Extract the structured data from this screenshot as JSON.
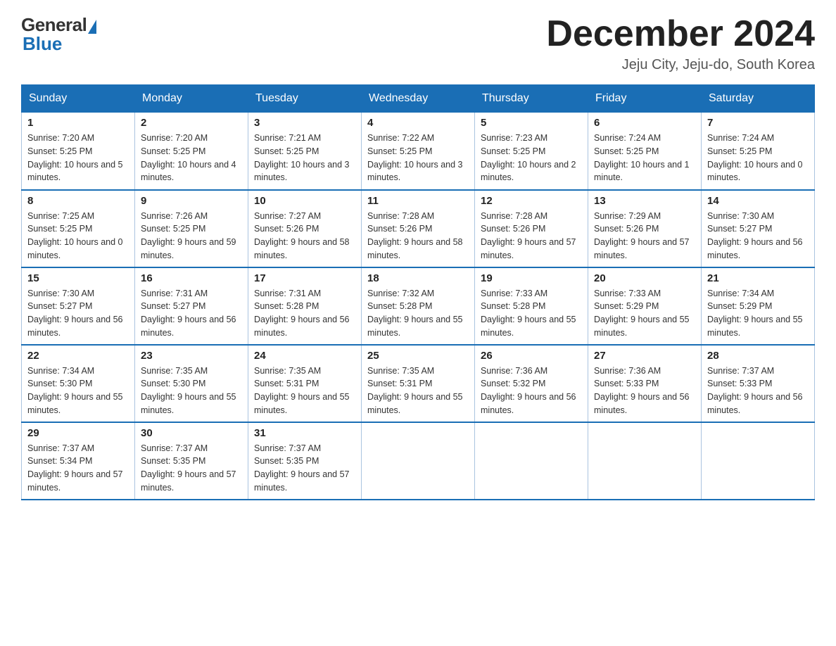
{
  "header": {
    "logo_general": "General",
    "logo_blue": "Blue",
    "month_title": "December 2024",
    "subtitle": "Jeju City, Jeju-do, South Korea"
  },
  "days_of_week": [
    "Sunday",
    "Monday",
    "Tuesday",
    "Wednesday",
    "Thursday",
    "Friday",
    "Saturday"
  ],
  "weeks": [
    [
      {
        "day": "1",
        "sunrise": "7:20 AM",
        "sunset": "5:25 PM",
        "daylight": "10 hours and 5 minutes."
      },
      {
        "day": "2",
        "sunrise": "7:20 AM",
        "sunset": "5:25 PM",
        "daylight": "10 hours and 4 minutes."
      },
      {
        "day": "3",
        "sunrise": "7:21 AM",
        "sunset": "5:25 PM",
        "daylight": "10 hours and 3 minutes."
      },
      {
        "day": "4",
        "sunrise": "7:22 AM",
        "sunset": "5:25 PM",
        "daylight": "10 hours and 3 minutes."
      },
      {
        "day": "5",
        "sunrise": "7:23 AM",
        "sunset": "5:25 PM",
        "daylight": "10 hours and 2 minutes."
      },
      {
        "day": "6",
        "sunrise": "7:24 AM",
        "sunset": "5:25 PM",
        "daylight": "10 hours and 1 minute."
      },
      {
        "day": "7",
        "sunrise": "7:24 AM",
        "sunset": "5:25 PM",
        "daylight": "10 hours and 0 minutes."
      }
    ],
    [
      {
        "day": "8",
        "sunrise": "7:25 AM",
        "sunset": "5:25 PM",
        "daylight": "10 hours and 0 minutes."
      },
      {
        "day": "9",
        "sunrise": "7:26 AM",
        "sunset": "5:25 PM",
        "daylight": "9 hours and 59 minutes."
      },
      {
        "day": "10",
        "sunrise": "7:27 AM",
        "sunset": "5:26 PM",
        "daylight": "9 hours and 58 minutes."
      },
      {
        "day": "11",
        "sunrise": "7:28 AM",
        "sunset": "5:26 PM",
        "daylight": "9 hours and 58 minutes."
      },
      {
        "day": "12",
        "sunrise": "7:28 AM",
        "sunset": "5:26 PM",
        "daylight": "9 hours and 57 minutes."
      },
      {
        "day": "13",
        "sunrise": "7:29 AM",
        "sunset": "5:26 PM",
        "daylight": "9 hours and 57 minutes."
      },
      {
        "day": "14",
        "sunrise": "7:30 AM",
        "sunset": "5:27 PM",
        "daylight": "9 hours and 56 minutes."
      }
    ],
    [
      {
        "day": "15",
        "sunrise": "7:30 AM",
        "sunset": "5:27 PM",
        "daylight": "9 hours and 56 minutes."
      },
      {
        "day": "16",
        "sunrise": "7:31 AM",
        "sunset": "5:27 PM",
        "daylight": "9 hours and 56 minutes."
      },
      {
        "day": "17",
        "sunrise": "7:31 AM",
        "sunset": "5:28 PM",
        "daylight": "9 hours and 56 minutes."
      },
      {
        "day": "18",
        "sunrise": "7:32 AM",
        "sunset": "5:28 PM",
        "daylight": "9 hours and 55 minutes."
      },
      {
        "day": "19",
        "sunrise": "7:33 AM",
        "sunset": "5:28 PM",
        "daylight": "9 hours and 55 minutes."
      },
      {
        "day": "20",
        "sunrise": "7:33 AM",
        "sunset": "5:29 PM",
        "daylight": "9 hours and 55 minutes."
      },
      {
        "day": "21",
        "sunrise": "7:34 AM",
        "sunset": "5:29 PM",
        "daylight": "9 hours and 55 minutes."
      }
    ],
    [
      {
        "day": "22",
        "sunrise": "7:34 AM",
        "sunset": "5:30 PM",
        "daylight": "9 hours and 55 minutes."
      },
      {
        "day": "23",
        "sunrise": "7:35 AM",
        "sunset": "5:30 PM",
        "daylight": "9 hours and 55 minutes."
      },
      {
        "day": "24",
        "sunrise": "7:35 AM",
        "sunset": "5:31 PM",
        "daylight": "9 hours and 55 minutes."
      },
      {
        "day": "25",
        "sunrise": "7:35 AM",
        "sunset": "5:31 PM",
        "daylight": "9 hours and 55 minutes."
      },
      {
        "day": "26",
        "sunrise": "7:36 AM",
        "sunset": "5:32 PM",
        "daylight": "9 hours and 56 minutes."
      },
      {
        "day": "27",
        "sunrise": "7:36 AM",
        "sunset": "5:33 PM",
        "daylight": "9 hours and 56 minutes."
      },
      {
        "day": "28",
        "sunrise": "7:37 AM",
        "sunset": "5:33 PM",
        "daylight": "9 hours and 56 minutes."
      }
    ],
    [
      {
        "day": "29",
        "sunrise": "7:37 AM",
        "sunset": "5:34 PM",
        "daylight": "9 hours and 57 minutes."
      },
      {
        "day": "30",
        "sunrise": "7:37 AM",
        "sunset": "5:35 PM",
        "daylight": "9 hours and 57 minutes."
      },
      {
        "day": "31",
        "sunrise": "7:37 AM",
        "sunset": "5:35 PM",
        "daylight": "9 hours and 57 minutes."
      },
      null,
      null,
      null,
      null
    ]
  ]
}
